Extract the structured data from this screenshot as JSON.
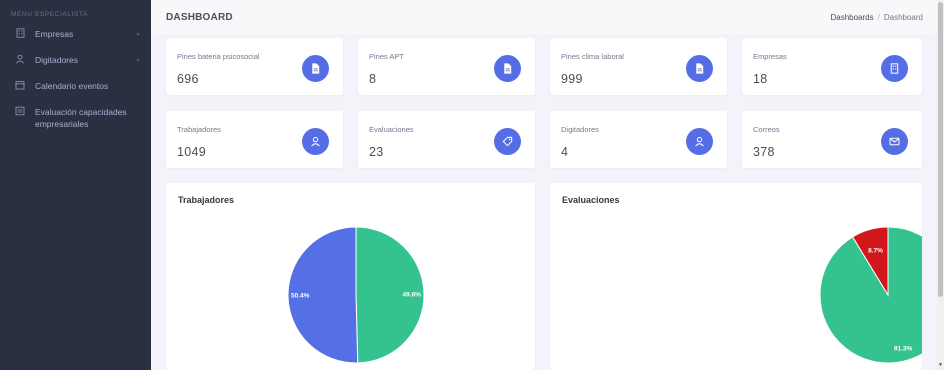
{
  "sidebar": {
    "menu_title": "MENU ESPECIALISTA",
    "items": [
      {
        "label": "Empresas",
        "icon": "building-icon",
        "has_chevron": true
      },
      {
        "label": "Digitadores",
        "icon": "user-icon",
        "has_chevron": true
      },
      {
        "label": "Calendario eventos",
        "icon": "calendar-icon",
        "has_chevron": false
      },
      {
        "label": "Evaluación capacidades empresariales",
        "icon": "document-icon",
        "has_chevron": false
      }
    ]
  },
  "header": {
    "title": "DASHBOARD",
    "breadcrumb": [
      "Dashboards",
      "Dashboard"
    ],
    "breadcrumb_sep": "/"
  },
  "stats": [
    {
      "label": "Pines bateria psicosocial",
      "value": "696",
      "icon": "document-icon"
    },
    {
      "label": "Pines APT",
      "value": "8",
      "icon": "document-icon"
    },
    {
      "label": "Pines clima laboral",
      "value": "999",
      "icon": "document-icon"
    },
    {
      "label": "Empresas",
      "value": "18",
      "icon": "building-icon"
    },
    {
      "label": "Trabajadores",
      "value": "1049",
      "icon": "user-icon"
    },
    {
      "label": "Evaluaciones",
      "value": "23",
      "icon": "tag-icon"
    },
    {
      "label": "Digitadores",
      "value": "4",
      "icon": "user-icon"
    },
    {
      "label": "Correos",
      "value": "378",
      "icon": "mail-icon"
    }
  ],
  "colors": {
    "accent": "#556ee6",
    "sidebar_bg": "#2a3042",
    "blue_slice": "#5470e4",
    "green_slice": "#34c38f",
    "red_slice": "#d1171b"
  },
  "chart_data": [
    {
      "type": "pie",
      "title": "Trabajadores",
      "slices": [
        {
          "label": "49.6%",
          "value": 49.6,
          "color": "#34c38f"
        },
        {
          "label": "50.4%",
          "value": 50.4,
          "color": "#5470e4"
        }
      ]
    },
    {
      "type": "pie",
      "title": "Evaluaciones",
      "slices": [
        {
          "label": "91.3%",
          "value": 91.3,
          "color": "#34c38f"
        },
        {
          "label": "8.7%",
          "value": 8.7,
          "color": "#d1171b"
        }
      ]
    }
  ]
}
